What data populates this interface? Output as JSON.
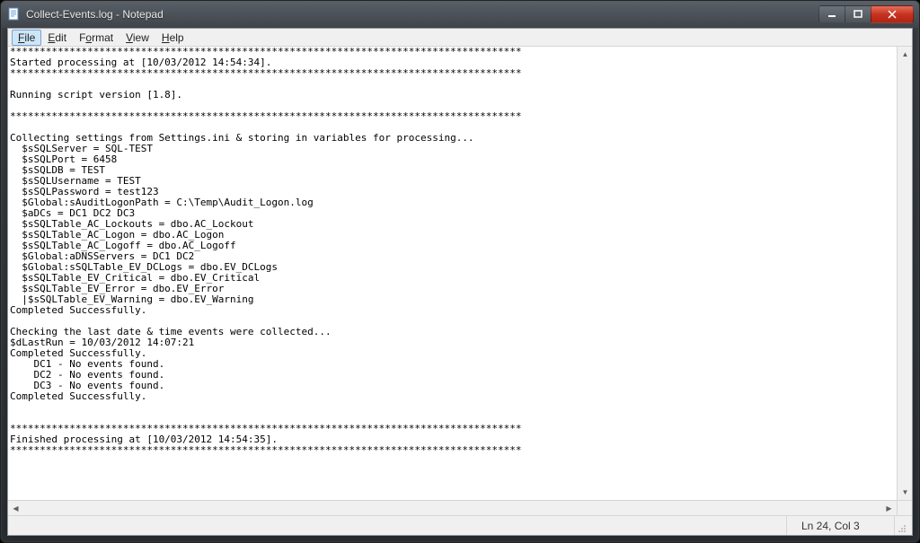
{
  "window": {
    "title": "Collect-Events.log - Notepad"
  },
  "menu": {
    "file": "File",
    "edit": "Edit",
    "format": "Format",
    "view": "View",
    "help": "Help"
  },
  "content": "**************************************************************************************\nStarted processing at [10/03/2012 14:54:34].\n**************************************************************************************\n\nRunning script version [1.8].\n\n**************************************************************************************\n\nCollecting settings from Settings.ini & storing in variables for processing...\n  $sSQLServer = SQL-TEST\n  $sSQLPort = 6458\n  $sSQLDB = TEST\n  $sSQLUsername = TEST\n  $sSQLPassword = test123\n  $Global:sAuditLogonPath = C:\\Temp\\Audit_Logon.log\n  $aDCs = DC1 DC2 DC3\n  $sSQLTable_AC_Lockouts = dbo.AC_Lockout\n  $sSQLTable_AC_Logon = dbo.AC_Logon\n  $sSQLTable_AC_Logoff = dbo.AC_Logoff\n  $Global:aDNSServers = DC1 DC2\n  $Global:sSQLTable_EV_DCLogs = dbo.EV_DCLogs\n  $sSQLTable_EV_Critical = dbo.EV_Critical\n  $sSQLTable_EV_Error = dbo.EV_Error\n  |$sSQLTable_EV_Warning = dbo.EV_Warning\nCompleted Successfully.\n\nChecking the last date & time events were collected...\n$dLastRun = 10/03/2012 14:07:21\nCompleted Successfully.\n    DC1 - No events found.\n    DC2 - No events found.\n    DC3 - No events found.\nCompleted Successfully.\n\n\n**************************************************************************************\nFinished processing at [10/03/2012 14:54:35].\n**************************************************************************************",
  "status": {
    "position": "Ln 24, Col 3"
  }
}
